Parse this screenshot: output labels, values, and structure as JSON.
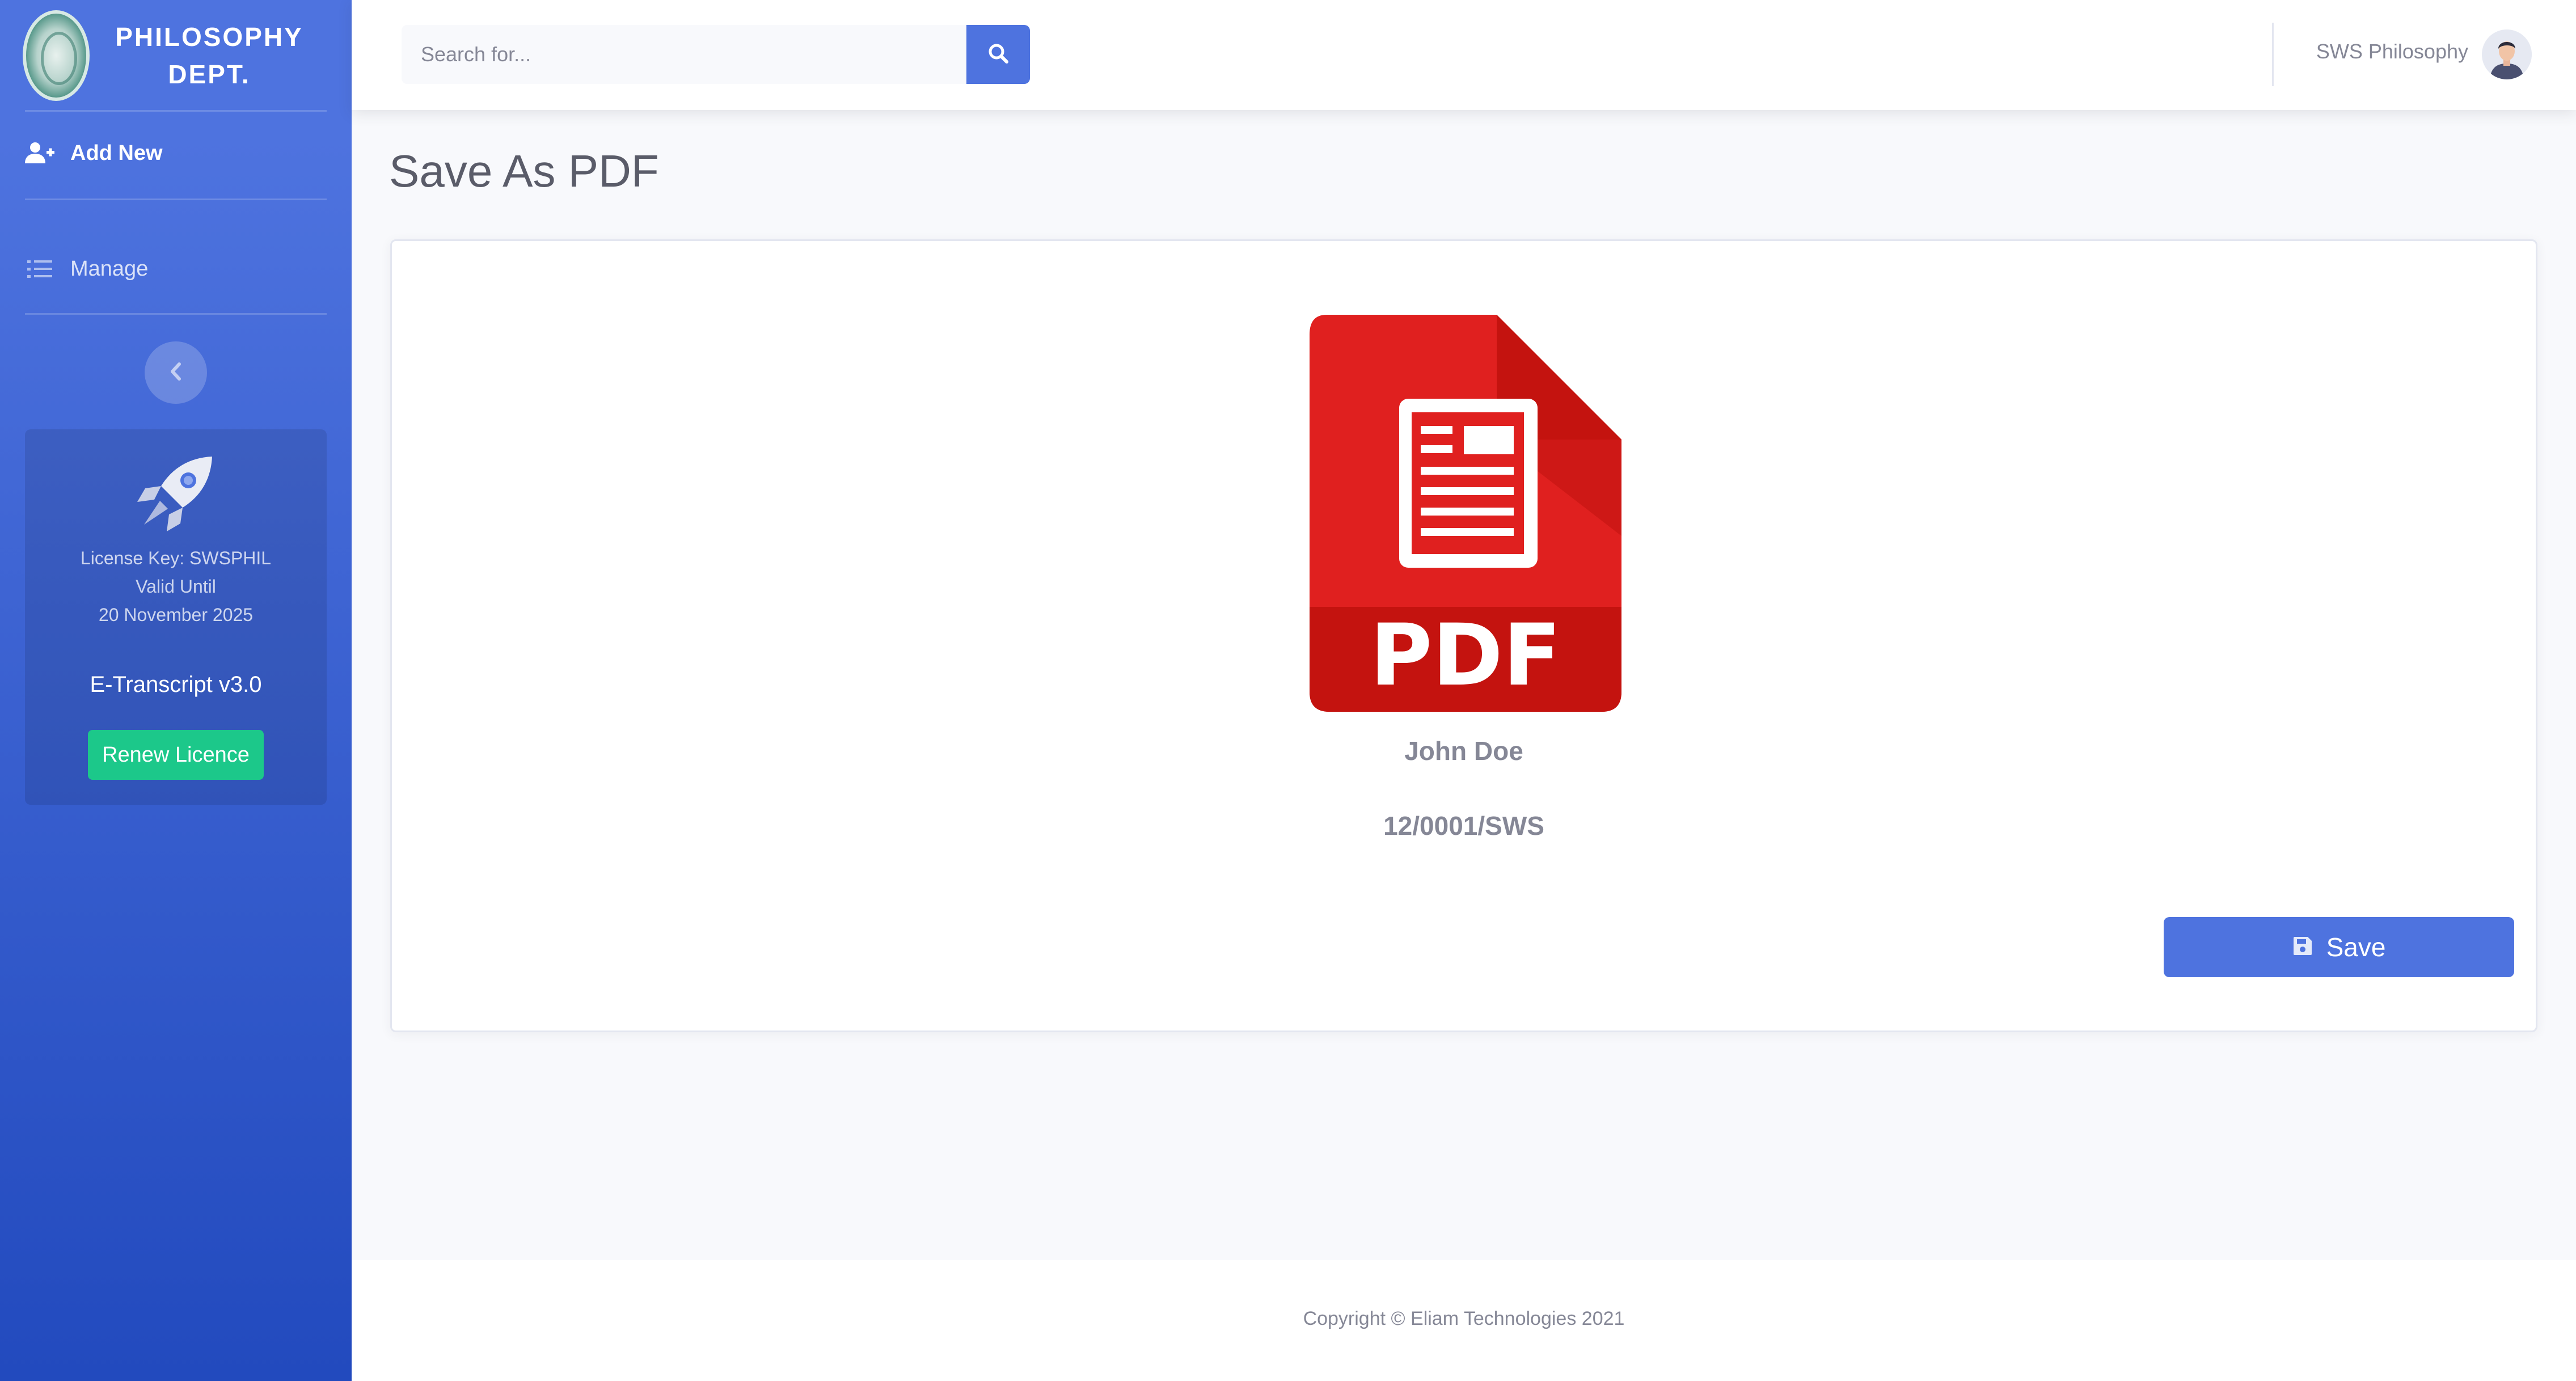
{
  "sidebar": {
    "brand": "PHILOSOPHY\nDEPT.",
    "nav": {
      "add_new": "Add New",
      "manage": "Manage"
    },
    "promo": {
      "license_key": "License Key: SWSPHIL",
      "valid_until": "Valid Until",
      "expiry_date": "20 November 2025",
      "version": "E-Transcript v3.0",
      "renew_label": "Renew Licence"
    }
  },
  "topbar": {
    "search_placeholder": "Search for...",
    "user_name": "SWS Philosophy"
  },
  "main": {
    "page_title": "Save As PDF",
    "pdf_label": "PDF",
    "student_name": "John Doe",
    "student_id": "12/0001/SWS",
    "save_label": "Save"
  },
  "footer": {
    "copyright": "Copyright © Eliam Technologies 2021"
  },
  "colors": {
    "primary": "#4e73df",
    "success": "#1cc88a",
    "pdf_red": "#e0201f"
  },
  "icons": {
    "search": "search-icon",
    "add_user": "user-plus-icon",
    "manage": "list-check-icon",
    "collapse": "chevron-left-icon",
    "rocket": "rocket-icon",
    "save": "floppy-disk-icon"
  }
}
